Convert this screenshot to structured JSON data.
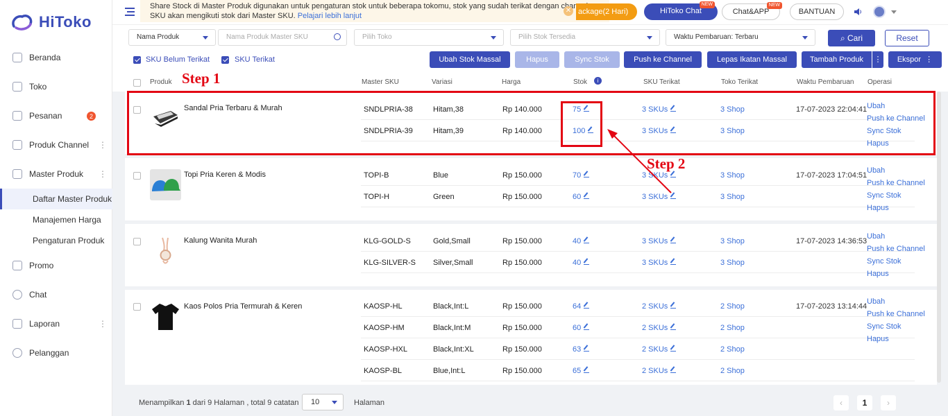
{
  "brand": {
    "name": "HiToko",
    "accent": "#3b4db8"
  },
  "sidebar": {
    "items": [
      {
        "label": "Beranda",
        "icon": "monitor-icon"
      },
      {
        "label": "Toko",
        "icon": "store-icon"
      },
      {
        "label": "Pesanan",
        "icon": "order-icon",
        "badge": "2"
      },
      {
        "label": "Produk Channel",
        "icon": "grid-icon"
      },
      {
        "label": "Master Produk",
        "icon": "cube-icon"
      }
    ],
    "sub_items": [
      "Daftar Master Produk",
      "Manajemen Harga",
      "Pengaturan Produk"
    ],
    "items_after": [
      {
        "label": "Promo",
        "icon": "promo-icon"
      },
      {
        "label": "Chat",
        "icon": "chat-icon"
      },
      {
        "label": "Laporan",
        "icon": "report-icon"
      },
      {
        "label": "Pelanggan",
        "icon": "customer-icon"
      }
    ]
  },
  "topbar": {
    "notice_text": "Share Stock di Master Produk digunakan untuk pengaturan stok untuk beberapa tokomu, stok yang sudah terikat dengan channel SKU akan mengikuti stok dari Master SKU.",
    "notice_link": "Pelajari lebih lanjut",
    "package_label": "ackage(2 Hari)",
    "chat_label": "HiToko Chat",
    "app_label": "Chat&APP",
    "help_label": "BANTUAN",
    "new_tag": "NEW"
  },
  "filters": {
    "field_select": "Nama Produk",
    "search_placeholder": "Nama Produk Master SKU",
    "shop_placeholder": "Pilih Toko",
    "stock_placeholder": "Pilih Stok Tersedia",
    "sort_select": "Waktu Pembaruan: Terbaru",
    "search_button": "Cari",
    "reset_button": "Reset",
    "chk_unbound": "SKU Belum Terikat",
    "chk_bound": "SKU Terikat"
  },
  "actions": {
    "bulk_stock": "Ubah Stok Massal",
    "delete": "Hapus",
    "sync": "Sync Stok",
    "push": "Push ke Channel",
    "unbind": "Lepas Ikatan Massal",
    "add": "Tambah Produk",
    "export": "Ekspor"
  },
  "table": {
    "headers": {
      "product": "Produk",
      "master_sku": "Master SKU",
      "variant": "Variasi",
      "price": "Harga",
      "stock": "Stok",
      "sku_bound": "SKU Terikat",
      "shop_bound": "Toko Terikat",
      "updated": "Waktu Pembaruan",
      "ops": "Operasi"
    },
    "ops": {
      "edit": "Ubah",
      "push": "Push ke Channel",
      "sync": "Sync Stok",
      "delete": "Hapus"
    },
    "products": [
      {
        "name": "Sandal Pria Terbaru & Murah",
        "updated": "17-07-2023 22:04:41",
        "rows": [
          {
            "sku": "SNDLPRIA-38",
            "variant": "Hitam,38",
            "price": "Rp 140.000",
            "stock": "75",
            "skus": "3 SKUs",
            "shops": "3 Shop"
          },
          {
            "sku": "SNDLPRIA-39",
            "variant": "Hitam,39",
            "price": "Rp 140.000",
            "stock": "100",
            "skus": "3 SKUs",
            "shops": "3 Shop"
          }
        ]
      },
      {
        "name": "Topi Pria Keren & Modis",
        "updated": "17-07-2023 17:04:51",
        "rows": [
          {
            "sku": "TOPI-B",
            "variant": "Blue",
            "price": "Rp 150.000",
            "stock": "70",
            "skus": "3 SKUs",
            "shops": "3 Shop"
          },
          {
            "sku": "TOPI-H",
            "variant": "Green",
            "price": "Rp 150.000",
            "stock": "60",
            "skus": "3 SKUs",
            "shops": "3 Shop"
          }
        ]
      },
      {
        "name": "Kalung Wanita Murah",
        "updated": "17-07-2023 14:36:53",
        "rows": [
          {
            "sku": "KLG-GOLD-S",
            "variant": "Gold,Small",
            "price": "Rp 150.000",
            "stock": "40",
            "skus": "3 SKUs",
            "shops": "3 Shop"
          },
          {
            "sku": "KLG-SILVER-S",
            "variant": "Silver,Small",
            "price": "Rp 150.000",
            "stock": "40",
            "skus": "3 SKUs",
            "shops": "3 Shop"
          }
        ]
      },
      {
        "name": "Kaos Polos Pria Termurah & Keren",
        "updated": "17-07-2023 13:14:44",
        "rows": [
          {
            "sku": "KAOSP-HL",
            "variant": "Black,Int:L",
            "price": "Rp 150.000",
            "stock": "64",
            "skus": "2 SKUs",
            "shops": "2 Shop"
          },
          {
            "sku": "KAOSP-HM",
            "variant": "Black,Int:M",
            "price": "Rp 150.000",
            "stock": "60",
            "skus": "2 SKUs",
            "shops": "2 Shop"
          },
          {
            "sku": "KAOSP-HXL",
            "variant": "Black,Int:XL",
            "price": "Rp 150.000",
            "stock": "63",
            "skus": "2 SKUs",
            "shops": "2 Shop"
          },
          {
            "sku": "KAOSP-BL",
            "variant": "Blue,Int:L",
            "price": "Rp 150.000",
            "stock": "65",
            "skus": "2 SKUs",
            "shops": "2 Shop"
          }
        ]
      }
    ]
  },
  "annotations": {
    "step1": "Step 1",
    "step2": "Step 2",
    "color": "#e30613"
  },
  "footer": {
    "summary_prefix": "Menampilkan",
    "current_page": "1",
    "summary_mid": "dari 9 Halaman , total 9 catatan",
    "page_size": "10",
    "page_label": "Halaman",
    "page_number": "1"
  }
}
